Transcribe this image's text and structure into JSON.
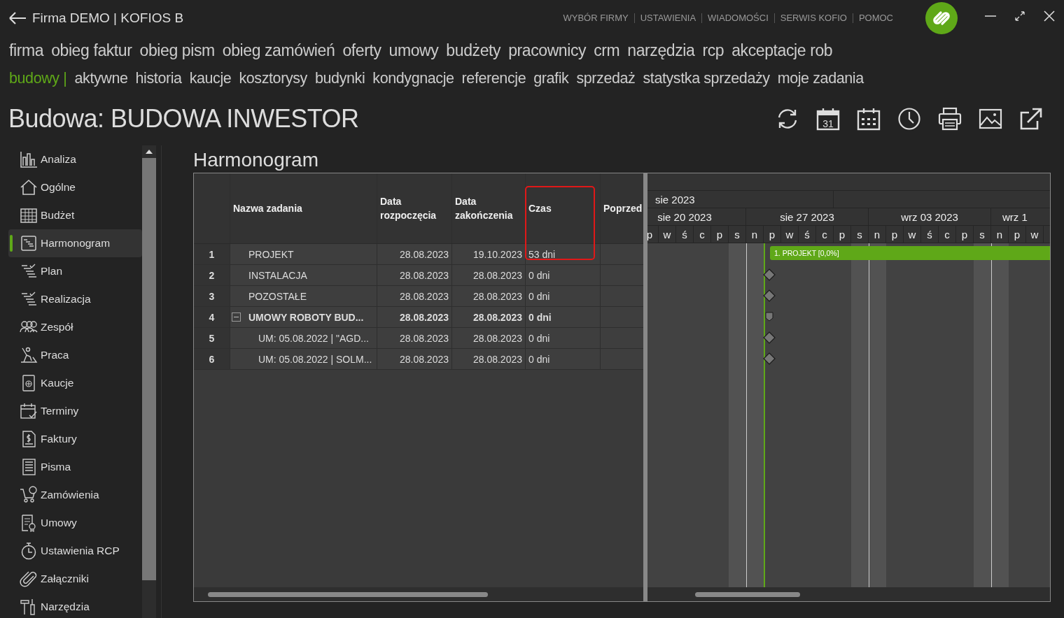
{
  "window": {
    "title": "Firma DEMO | KOFIOS B"
  },
  "top_links": [
    "WYBÓR FIRMY",
    "USTAWIENIA",
    "WIADOMOŚCI",
    "SERWIS KOFIO",
    "POMOC"
  ],
  "main_menu": [
    "firma",
    "obieg faktur",
    "obieg pism",
    "obieg zamówień",
    "oferty",
    "umowy",
    "budżety",
    "pracownicy",
    "crm",
    "narzędzia",
    "rcp",
    "akceptacje rob"
  ],
  "sub_menu": {
    "section": "budowy |",
    "items": [
      "aktywne",
      "historia",
      "kaucje",
      "kosztorysy",
      "budynki",
      "kondygnacje",
      "referencje",
      "grafik",
      "sprzedaż",
      "statystka sprzedaży",
      "moje zadania"
    ]
  },
  "page_title": "Budowa: BUDOWA INWESTOR",
  "toolbar": {
    "calendar_day": "31"
  },
  "sidebar": {
    "items": [
      {
        "label": "Analiza",
        "selected": false
      },
      {
        "label": "Ogólne",
        "selected": false
      },
      {
        "label": "Budżet",
        "selected": false
      },
      {
        "label": "Harmonogram",
        "selected": true
      },
      {
        "label": "Plan",
        "selected": false
      },
      {
        "label": "Realizacja",
        "selected": false
      },
      {
        "label": "Zespół",
        "selected": false
      },
      {
        "label": "Praca",
        "selected": false
      },
      {
        "label": "Kaucje",
        "selected": false
      },
      {
        "label": "Terminy",
        "selected": false
      },
      {
        "label": "Faktury",
        "selected": false
      },
      {
        "label": "Pisma",
        "selected": false
      },
      {
        "label": "Zamówienia",
        "selected": false
      },
      {
        "label": "Umowy",
        "selected": false
      },
      {
        "label": "Ustawienia RCP",
        "selected": false
      },
      {
        "label": "Załączniki",
        "selected": false
      },
      {
        "label": "Narzędzia",
        "selected": false
      }
    ]
  },
  "section_title": "Harmonogram",
  "table": {
    "columns": [
      {
        "label": "Nazwa zadania",
        "highlighted": false
      },
      {
        "label": "Data rozpoczęcia",
        "highlighted": false
      },
      {
        "label": "Data zakończenia",
        "highlighted": false
      },
      {
        "label": "Czas",
        "highlighted": true
      },
      {
        "label": "Poprzed",
        "highlighted": false
      }
    ],
    "rows": [
      {
        "num": "1",
        "name": "PROJEKT",
        "start": "28.08.2023",
        "end": "19.10.2023",
        "duration": "53 dni",
        "kind": "bar",
        "bar_label": "1. PROJEKT [0,0%]"
      },
      {
        "num": "2",
        "name": "INSTALACJA",
        "start": "28.08.2023",
        "end": "28.08.2023",
        "duration": "0 dni",
        "kind": "milestone"
      },
      {
        "num": "3",
        "name": "POZOSTAŁE",
        "start": "28.08.2023",
        "end": "28.08.2023",
        "duration": "0 dni",
        "kind": "milestone"
      },
      {
        "num": "4",
        "name": "UMOWY ROBOTY BUD...",
        "start": "28.08.2023",
        "end": "28.08.2023",
        "duration": "0 dni",
        "kind": "summary",
        "expanded": true,
        "children": [
          {
            "num": "5",
            "name": "UM: 05.08.2022 | \"AGD...",
            "start": "28.08.2023",
            "end": "28.08.2023",
            "duration": "0 dni",
            "kind": "milestone"
          },
          {
            "num": "6",
            "name": "UM: 05.08.2022 | SOLM...",
            "start": "28.08.2023",
            "end": "28.08.2023",
            "duration": "0 dni",
            "kind": "milestone"
          }
        ]
      }
    ]
  },
  "timeline": {
    "months": [
      "sie 2023"
    ],
    "weeks": [
      "sie 20 2023",
      "sie 27 2023",
      "wrz 03 2023",
      "wrz 1"
    ],
    "days": [
      {
        "label": "p",
        "weekend": false
      },
      {
        "label": "w",
        "weekend": false
      },
      {
        "label": "ś",
        "weekend": false
      },
      {
        "label": "c",
        "weekend": false
      },
      {
        "label": "p",
        "weekend": false
      },
      {
        "label": "s",
        "weekend": true
      },
      {
        "label": "n",
        "weekend": true
      },
      {
        "label": "p",
        "weekend": false
      },
      {
        "label": "w",
        "weekend": false
      },
      {
        "label": "ś",
        "weekend": false
      },
      {
        "label": "c",
        "weekend": false
      },
      {
        "label": "p",
        "weekend": false
      },
      {
        "label": "s",
        "weekend": true
      },
      {
        "label": "n",
        "weekend": true
      },
      {
        "label": "p",
        "weekend": false
      },
      {
        "label": "w",
        "weekend": false
      },
      {
        "label": "ś",
        "weekend": false
      },
      {
        "label": "c",
        "weekend": false
      },
      {
        "label": "p",
        "weekend": false
      },
      {
        "label": "s",
        "weekend": true
      },
      {
        "label": "n",
        "weekend": true
      },
      {
        "label": "p",
        "weekend": false
      },
      {
        "label": "w",
        "weekend": false
      }
    ]
  }
}
